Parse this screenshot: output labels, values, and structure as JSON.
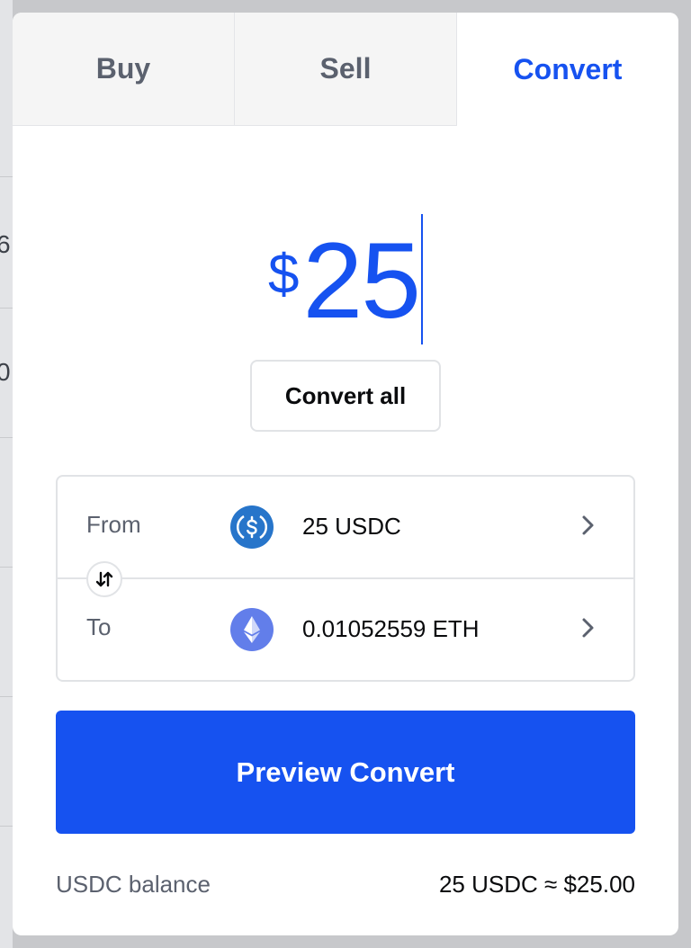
{
  "background": {
    "fragments": [
      "6",
      "0"
    ]
  },
  "tabs": [
    {
      "label": "Buy",
      "active": false
    },
    {
      "label": "Sell",
      "active": false
    },
    {
      "label": "Convert",
      "active": true
    }
  ],
  "amount": {
    "currency_symbol": "$",
    "value": "25"
  },
  "convert_all_label": "Convert all",
  "conversion": {
    "from": {
      "label": "From",
      "value": "25 USDC",
      "icon": "usdc-coin-icon"
    },
    "to": {
      "label": "To",
      "value": "0.01052559 ETH",
      "icon": "eth-coin-icon"
    }
  },
  "preview_button_label": "Preview Convert",
  "balance": {
    "label": "USDC balance",
    "value": "25 USDC ≈ $25.00"
  },
  "colors": {
    "accent": "#1652f0",
    "usdc": "#2775ca",
    "eth": "#627eea",
    "muted_text": "#5b616e"
  }
}
